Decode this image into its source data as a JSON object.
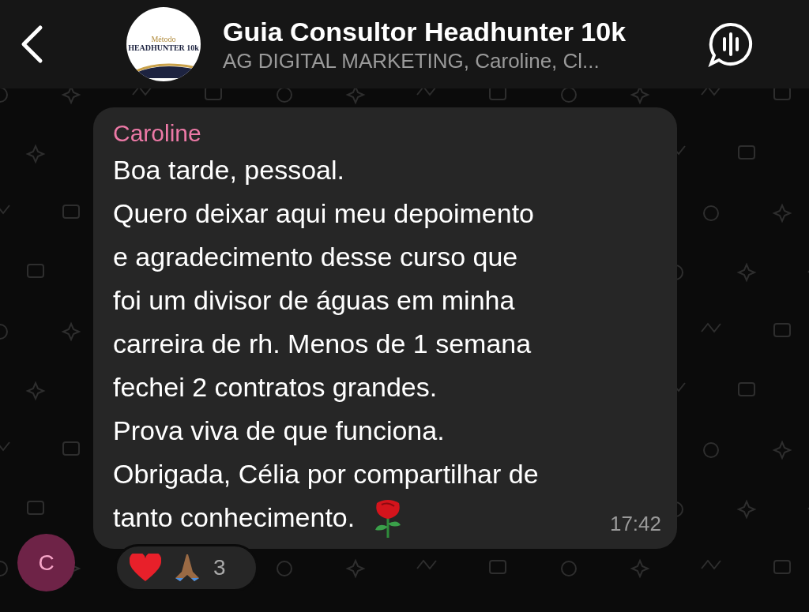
{
  "header": {
    "title": "Guia Consultor Headhunter 10k",
    "subtitle": "AG DIGITAL MARKETING, Caroline, Cl...",
    "logo": {
      "top": "Método",
      "main": "HEADHUNTER 10k"
    }
  },
  "message": {
    "sender": "Caroline",
    "avatar_letter": "C",
    "lines": [
      "Boa tarde, pessoal.",
      "Quero deixar aqui meu depoimento",
      "e agradecimento desse curso que",
      "foi um divisor de águas em minha",
      "carreira de rh. Menos de 1 semana",
      "fechei 2 contratos grandes.",
      "Prova viva de que funciona.",
      "Obrigada, Célia por compartilhar de",
      "tanto conhecimento."
    ],
    "time": "17:42",
    "reactions": {
      "count": "3"
    }
  }
}
